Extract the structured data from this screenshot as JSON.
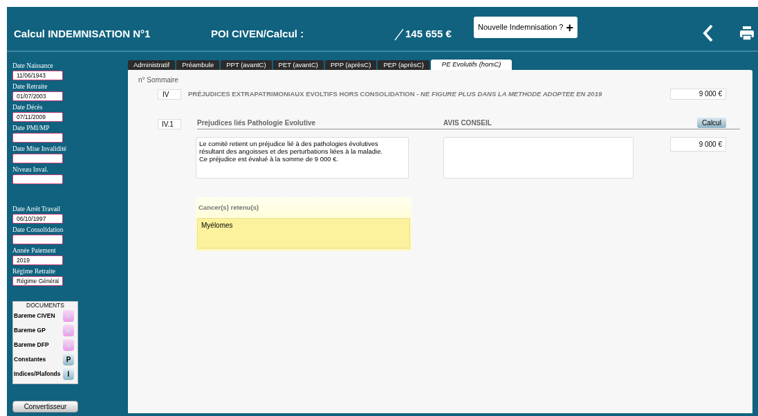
{
  "header": {
    "title": "Calcul INDEMNISATION N°1",
    "subtitle": "POI CIVEN/Calcul :",
    "total": "145 655 €",
    "new_button": {
      "label": "Nouvelle Indemnisation ?",
      "icon": "+"
    }
  },
  "sidebar": {
    "groups": [
      [
        {
          "label": "Date Naissance",
          "value": "11/06/1943"
        },
        {
          "label": "Date Retraite",
          "value": "01/07/2003"
        },
        {
          "label": "Date Décès",
          "value": "07/11/2009"
        },
        {
          "label": "Date PMI/MP"
        },
        {
          "label": "Date Mise Invalidité"
        },
        {
          "label": "Niveau Inval."
        }
      ],
      [
        {
          "label": "Date Arrêt Travail",
          "value": "06/10/1997"
        },
        {
          "label": "Date Consolidation"
        },
        {
          "label": "Année Paiement",
          "value": "2019"
        },
        {
          "label": "Régime Retraite",
          "value": "Régime Général"
        }
      ]
    ],
    "documents": {
      "title": "DOCUMENTS",
      "items": [
        {
          "label": "Bareme CIVEN",
          "kind": "doc"
        },
        {
          "label": "Bareme GP",
          "kind": "doc"
        },
        {
          "label": "Bareme DFP",
          "kind": "doc"
        },
        {
          "label": "Constantes",
          "kind": "letter",
          "letter": "P"
        },
        {
          "label": "Indices/Plafonds",
          "kind": "letter",
          "letter": "I"
        }
      ]
    },
    "convert_button": "Convertisseur"
  },
  "tabs": [
    {
      "label": "Administratif",
      "selected": false
    },
    {
      "label": "Préambule",
      "selected": false
    },
    {
      "label": "PPT (avantC)",
      "selected": false
    },
    {
      "label": "PET (avantC)",
      "selected": false
    },
    {
      "label": "PPP (aprèsC)",
      "selected": false
    },
    {
      "label": "PEP (aprèsC)",
      "selected": false
    },
    {
      "label": "PE Evolutifs (horsC)",
      "selected": true
    }
  ],
  "main": {
    "sommaire_label": "n° Sommaire",
    "section": {
      "number": "IV",
      "title": "PRÉJUDICES EXTRAPATRIMONIAUX EVOLTIFS HORS CONSOLIDATION - *NE FIGURE PLUS DANS LA METHODE ADOPTEE EN 2019*",
      "amount": "9 000 €"
    },
    "subsection": {
      "number": "IV.1",
      "heading": "Prejudices liés Pathologie Evolutive",
      "avis_heading": "AVIS CONSEIL",
      "calc_button": "Calcul",
      "text": "Le comité retient un préjudice lié à des pathologies évolutives\nrésultant des angoisses et des perturbations liées à la maladie.\nCe préjudice est évalué à la somme de 9 000 €.",
      "amount": "9 000 €"
    },
    "cancers": {
      "label": "Cancer(s) retenu(s)",
      "value": "Myélomes"
    }
  }
}
